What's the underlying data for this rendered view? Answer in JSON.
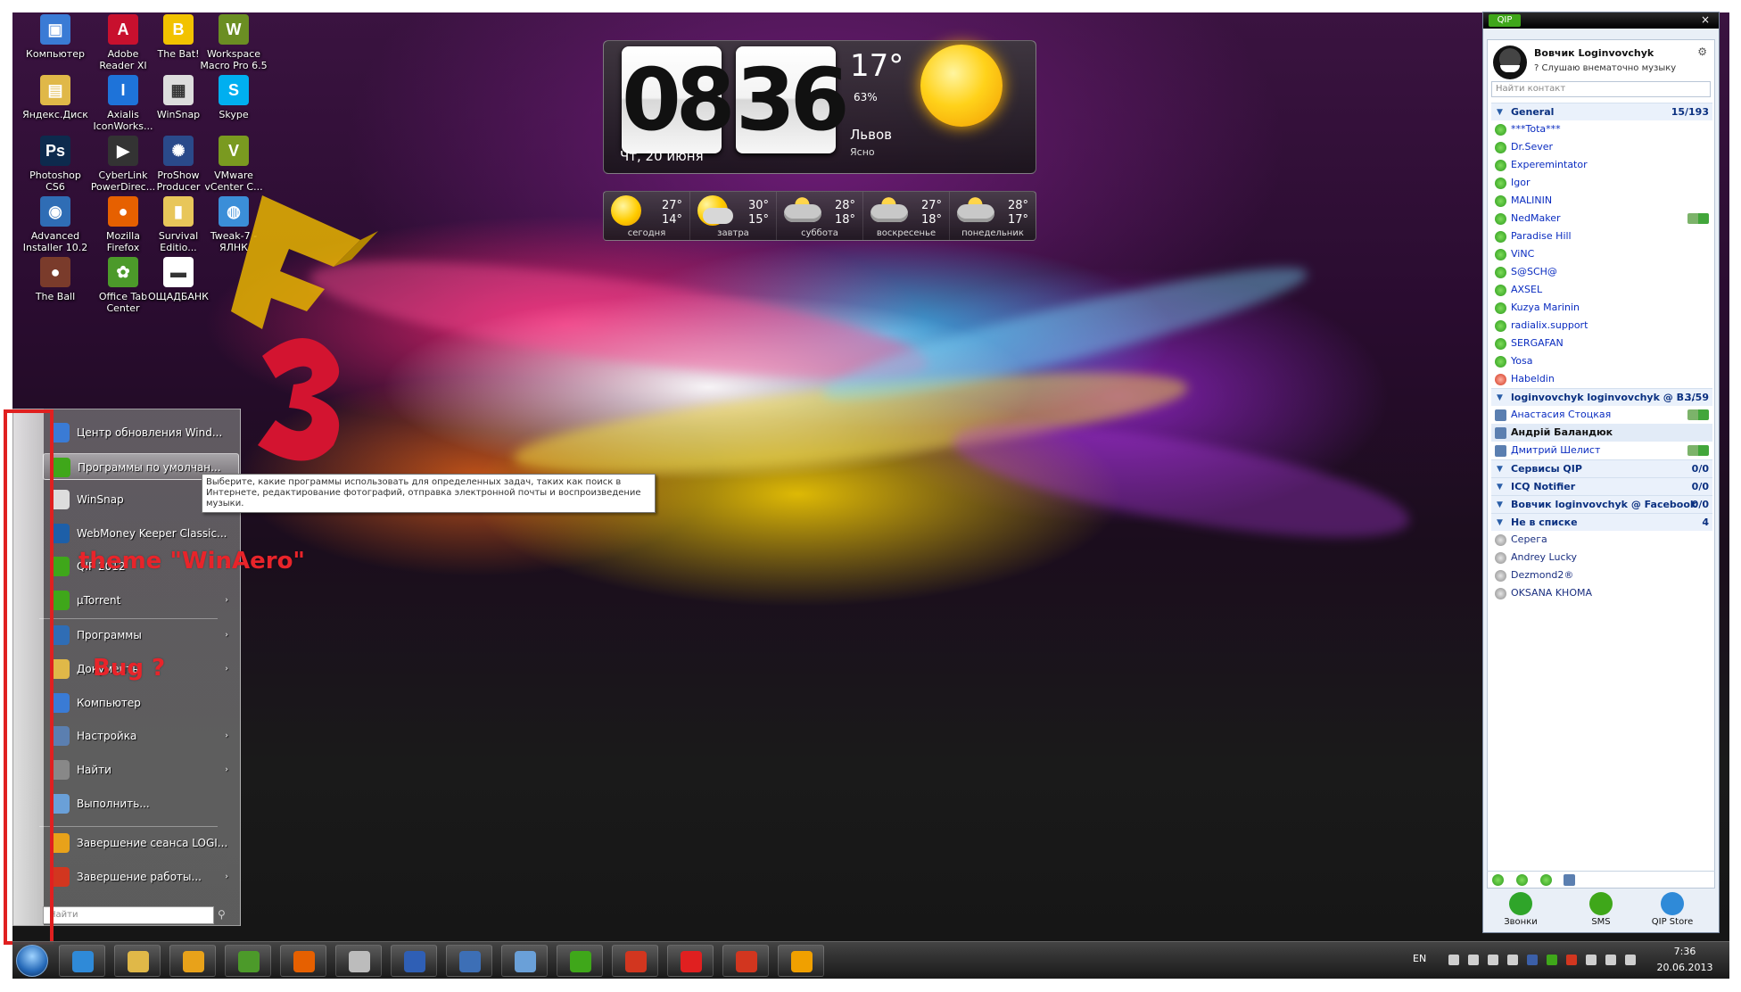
{
  "desktop": {
    "icons": [
      {
        "label": "Компьютер",
        "icon": "computer-icon",
        "glyph": "▣",
        "color": "#3a7bd5"
      },
      {
        "label": "Adobe Reader XI",
        "icon": "adobe-reader-icon",
        "glyph": "A",
        "color": "#c8102e"
      },
      {
        "label": "The Bat!",
        "icon": "the-bat-icon",
        "glyph": "B",
        "color": "#f2c200"
      },
      {
        "label": "Workspace Macro Pro 6.5",
        "icon": "workspace-macro-icon",
        "glyph": "W",
        "color": "#6b8e23"
      },
      {
        "label": "Яндекс.Диск",
        "icon": "yandex-disk-icon",
        "glyph": "▤",
        "color": "#e0b848"
      },
      {
        "label": "Axialis IconWorks...",
        "icon": "axialis-icon",
        "glyph": "I",
        "color": "#1e73d9"
      },
      {
        "label": "WinSnap",
        "icon": "winsnap-icon",
        "glyph": "▦",
        "color": "#dddddd"
      },
      {
        "label": "Skype",
        "icon": "skype-icon",
        "glyph": "S",
        "color": "#00aff0"
      },
      {
        "label": "Photoshop CS6",
        "icon": "photoshop-icon",
        "glyph": "Ps",
        "color": "#0d2a4d"
      },
      {
        "label": "CyberLink PowerDirec...",
        "icon": "powerdirector-icon",
        "glyph": "▶",
        "color": "#333333"
      },
      {
        "label": "ProShow Producer",
        "icon": "proshow-icon",
        "glyph": "✺",
        "color": "#2a4a8a"
      },
      {
        "label": "VMware vCenter C...",
        "icon": "vmware-icon",
        "glyph": "V",
        "color": "#7a9a20"
      },
      {
        "label": "Advanced Installer 10.2",
        "icon": "advanced-installer-icon",
        "glyph": "◉",
        "color": "#2f6db5"
      },
      {
        "label": "Mozilla Firefox",
        "icon": "firefox-icon",
        "glyph": "●",
        "color": "#e66000"
      },
      {
        "label": "Survival Editio...",
        "icon": "folder-icon",
        "glyph": "▮",
        "color": "#e8c65a"
      },
      {
        "label": "Tweak-7 - ЯЛНК",
        "icon": "tweak7-icon",
        "glyph": "◍",
        "color": "#3b8ed8"
      },
      {
        "label": "The Ball",
        "icon": "the-ball-icon",
        "glyph": "●",
        "color": "#7a3b2b"
      },
      {
        "label": "Office Tab Center",
        "icon": "office-tab-icon",
        "glyph": "✿",
        "color": "#4c9a2a"
      },
      {
        "label": "ОЩАДБАНК",
        "icon": "oschadbank-icon",
        "glyph": "▬",
        "color": "#ffffff"
      }
    ]
  },
  "clock_widget": {
    "hours": "08",
    "minutes": "36",
    "date": "Чт, 20 июня",
    "temperature": "17°",
    "humidity": "63%",
    "city": "Львов",
    "condition": "Ясно"
  },
  "forecast": [
    {
      "day": "сегодня",
      "high": "27°",
      "low": "14°",
      "icon": "sunny"
    },
    {
      "day": "завтра",
      "high": "30°",
      "low": "15°",
      "icon": "partly-cloudy"
    },
    {
      "day": "суббота",
      "high": "28°",
      "low": "18°",
      "icon": "storm"
    },
    {
      "day": "воскресенье",
      "high": "27°",
      "low": "18°",
      "icon": "storm"
    },
    {
      "day": "понедельник",
      "high": "28°",
      "low": "17°",
      "icon": "storm"
    }
  ],
  "start_menu": {
    "recent": [
      {
        "label": "Центр обновления Wind...",
        "icon": "windows-update-icon",
        "color": "#3a7bd5",
        "arrow": ""
      },
      {
        "label": "Программы по умолчан...",
        "icon": "default-programs-icon",
        "color": "#3fa71a",
        "arrow": ""
      },
      {
        "label": "WinSnap",
        "icon": "winsnap-icon",
        "color": "#dddddd",
        "arrow": ""
      },
      {
        "label": "WebMoney Keeper Classic...",
        "icon": "webmoney-icon",
        "color": "#1d5fa8",
        "arrow": ""
      },
      {
        "label": "QIP 2012",
        "icon": "qip-icon",
        "color": "#3fa71a",
        "arrow": "›"
      },
      {
        "label": "µTorrent",
        "icon": "utorrent-icon",
        "color": "#3fa71a",
        "arrow": "›"
      }
    ],
    "system": [
      {
        "label": "Программы",
        "icon": "programs-icon",
        "color": "#2f6db5",
        "arrow": "›"
      },
      {
        "label": "Документы",
        "icon": "documents-icon",
        "color": "#e0b848",
        "arrow": "›"
      },
      {
        "label": "Компьютер",
        "icon": "computer-icon",
        "color": "#3a7bd5",
        "arrow": ""
      },
      {
        "label": "Настройка",
        "icon": "settings-icon",
        "color": "#5b7fb0",
        "arrow": "›"
      },
      {
        "label": "Найти",
        "icon": "search-icon",
        "color": "#888888",
        "arrow": "›"
      },
      {
        "label": "Выполнить...",
        "icon": "run-icon",
        "color": "#6aa0d8",
        "arrow": ""
      }
    ],
    "power": [
      {
        "label": "Завершение сеанса LOGI...",
        "icon": "logoff-icon",
        "color": "#e8a21a",
        "arrow": ""
      },
      {
        "label": "Завершение работы...",
        "icon": "shutdown-icon",
        "color": "#d2361f",
        "arrow": "›"
      }
    ],
    "search_placeholder": "Найти",
    "tooltip": "Выберите, какие программы использовать для определенных задач, таких как поиск в Интернете, редактирование фотографий, отправка электронной почты и воспроизведение музыки."
  },
  "annotations": {
    "theme": "theme \"WinAero\"",
    "bug": "Bug ?",
    "color": "#e8242a"
  },
  "qip": {
    "logo": "QIP",
    "close": "×",
    "user_name": "Вовчик Loginvovchyk",
    "user_status": "? Слушаю внематочно музыку",
    "search_placeholder": "Найти контакт",
    "rows": [
      {
        "type": "group",
        "label": "General",
        "count": "15/193"
      },
      {
        "type": "contact",
        "label": "***Tota***",
        "status": "green"
      },
      {
        "type": "contact",
        "label": "Dr.Sever",
        "status": "green"
      },
      {
        "type": "contact",
        "label": "Experemintator",
        "status": "green"
      },
      {
        "type": "contact",
        "label": "Igor",
        "status": "green"
      },
      {
        "type": "contact",
        "label": "MALININ",
        "status": "green"
      },
      {
        "type": "contact",
        "label": "NedMaker",
        "status": "green",
        "extra": true
      },
      {
        "type": "contact",
        "label": "Paradise Hill",
        "status": "green"
      },
      {
        "type": "contact",
        "label": "ViNC",
        "status": "green"
      },
      {
        "type": "contact",
        "label": "S@SCH@",
        "status": "green"
      },
      {
        "type": "contact",
        "label": "AXSEL",
        "status": "green"
      },
      {
        "type": "contact",
        "label": "Kuzya Marinin",
        "status": "green"
      },
      {
        "type": "contact",
        "label": "radialix.support",
        "status": "green"
      },
      {
        "type": "contact",
        "label": "SERGAFAN",
        "status": "green"
      },
      {
        "type": "contact",
        "label": "Yosa",
        "status": "green"
      },
      {
        "type": "contact",
        "label": "Habeldin",
        "status": "red"
      },
      {
        "type": "group",
        "label": "loginvovchyk loginvovchyk @ B...",
        "count": "3/59"
      },
      {
        "type": "contact",
        "label": "Анастасия Стоцкая",
        "status": "vk",
        "extra": true
      },
      {
        "type": "contact-bold",
        "label": "Андрій Баландюк",
        "status": "vk"
      },
      {
        "type": "contact",
        "label": "Дмитрий Шелист",
        "status": "vk",
        "extra": true
      },
      {
        "type": "group",
        "label": "Сервисы QIP",
        "count": "0/0"
      },
      {
        "type": "group",
        "label": "ICQ Notifier",
        "count": "0/0"
      },
      {
        "type": "group",
        "label": "Вовчик loginvovchyk @ Facebook",
        "count": "0/0"
      },
      {
        "type": "group",
        "label": "Не в списке",
        "count": "4"
      },
      {
        "type": "contact-nolist",
        "label": "Серега",
        "status": "grey"
      },
      {
        "type": "contact-nolist",
        "label": "Andrey Lucky",
        "status": "grey"
      },
      {
        "type": "contact-nolist",
        "label": "Dezmond2®",
        "status": "grey"
      },
      {
        "type": "contact-nolist",
        "label": "OKSANA KHOMA",
        "status": "grey"
      }
    ],
    "bottom_buttons": [
      {
        "label": "Звонки",
        "icon": "phone-icon",
        "color": "#2fa52a"
      },
      {
        "label": "SMS",
        "icon": "sms-icon",
        "color": "#3fa71a"
      },
      {
        "label": "QIP Store",
        "icon": "qip-store-icon",
        "color": "#2f8ad8"
      }
    ]
  },
  "taskbar": {
    "buttons": [
      {
        "name": "internet-explorer",
        "icon": "ie-icon",
        "color": "#2f8ad8"
      },
      {
        "name": "explorer",
        "icon": "folder-icon",
        "color": "#e0b848"
      },
      {
        "name": "media-player",
        "icon": "media-player-icon",
        "color": "#e8a21a"
      },
      {
        "name": "windows",
        "icon": "windows-icon",
        "color": "#4c9a2a"
      },
      {
        "name": "firefox",
        "icon": "firefox-icon",
        "color": "#e66000"
      },
      {
        "name": "app-cloud",
        "icon": "cloud-app-icon",
        "color": "#bcbcbc"
      },
      {
        "name": "save-app",
        "icon": "floppy-icon",
        "color": "#2f5fb5"
      },
      {
        "name": "xbmc",
        "icon": "xbmc-icon",
        "color": "#3d6fb6"
      },
      {
        "name": "gear-app",
        "icon": "gear-app-icon",
        "color": "#6aa0d8"
      },
      {
        "name": "qip",
        "icon": "qip-icon",
        "color": "#3fa71a"
      },
      {
        "name": "tools",
        "icon": "tools-icon",
        "color": "#d2361f"
      },
      {
        "name": "media-app",
        "icon": "media-app-icon",
        "color": "#e02020"
      },
      {
        "name": "recycle",
        "icon": "recycle-icon",
        "color": "#d2361f"
      },
      {
        "name": "winamp",
        "icon": "winamp-icon",
        "color": "#f0a000"
      }
    ],
    "lang": "EN",
    "time": "7:36",
    "date": "20.06.2013"
  }
}
